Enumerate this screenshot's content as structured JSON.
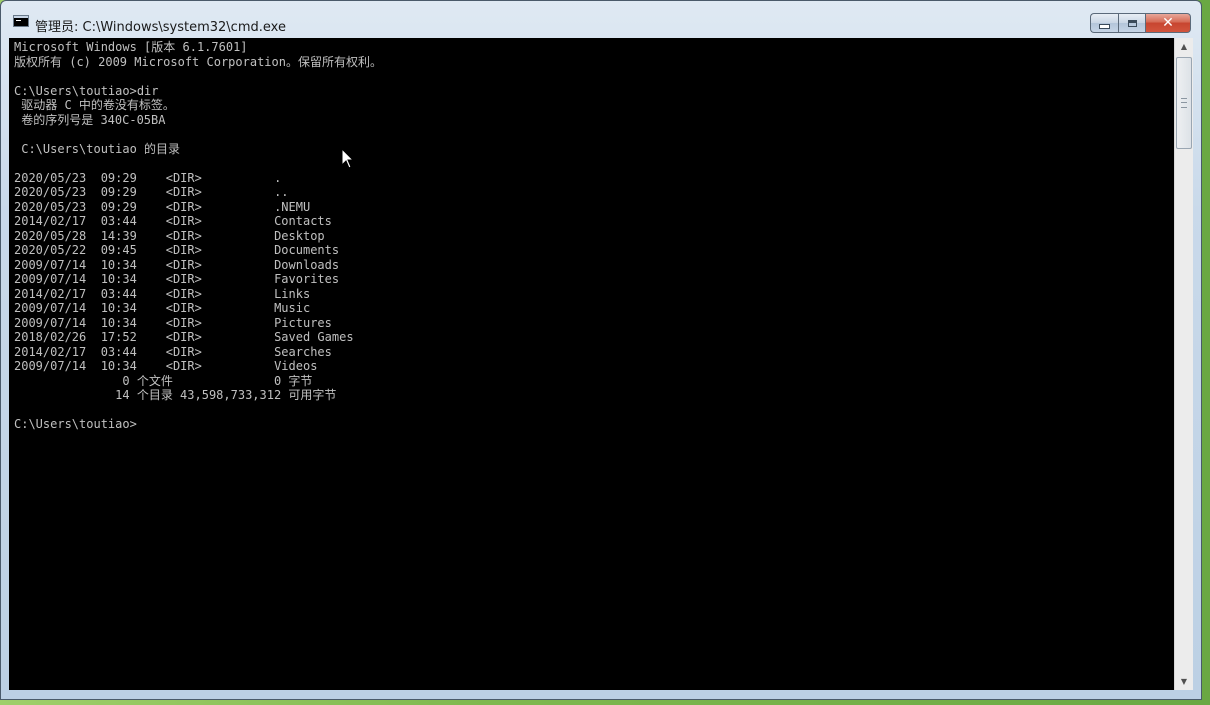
{
  "window": {
    "title": "管理员: C:\\Windows\\system32\\cmd.exe",
    "icon": "console-app-icon",
    "buttons": {
      "minimize": "minimize-icon",
      "maximize": "maximize-icon",
      "close_label": "✕"
    }
  },
  "console": {
    "background": "#000000",
    "foreground": "#c0c0c0",
    "lines": [
      "Microsoft Windows [版本 6.1.7601]",
      "版权所有 (c) 2009 Microsoft Corporation。保留所有权利。",
      "",
      "C:\\Users\\toutiao>dir",
      " 驱动器 C 中的卷没有标签。",
      " 卷的序列号是 340C-05BA",
      "",
      " C:\\Users\\toutiao 的目录",
      "",
      "2020/05/23  09:29    <DIR>          .",
      "2020/05/23  09:29    <DIR>          ..",
      "2020/05/23  09:29    <DIR>          .NEMU",
      "2014/02/17  03:44    <DIR>          Contacts",
      "2020/05/28  14:39    <DIR>          Desktop",
      "2020/05/22  09:45    <DIR>          Documents",
      "2009/07/14  10:34    <DIR>          Downloads",
      "2009/07/14  10:34    <DIR>          Favorites",
      "2014/02/17  03:44    <DIR>          Links",
      "2009/07/14  10:34    <DIR>          Music",
      "2009/07/14  10:34    <DIR>          Pictures",
      "2018/02/26  17:52    <DIR>          Saved Games",
      "2014/02/17  03:44    <DIR>          Searches",
      "2009/07/14  10:34    <DIR>          Videos",
      "               0 个文件              0 字节",
      "              14 个目录 43,598,733,312 可用字节",
      "",
      "C:\\Users\\toutiao>"
    ]
  },
  "scrollbar": {
    "up_arrow": "▲",
    "down_arrow": "▼"
  }
}
